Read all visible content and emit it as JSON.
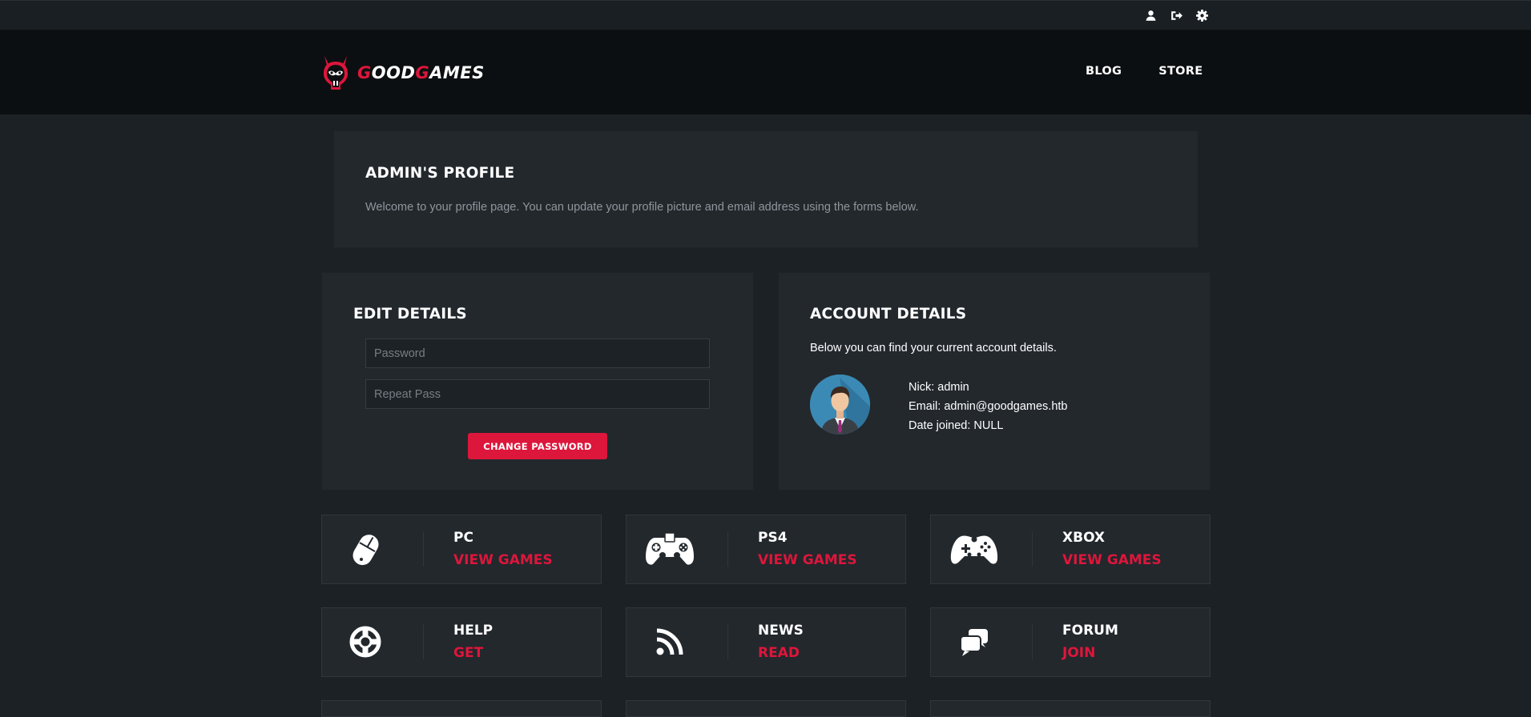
{
  "topbar": {
    "icons": [
      "user-icon",
      "sign-out-icon",
      "gear-icon"
    ]
  },
  "brand": {
    "part1": "G",
    "part2": "OOD",
    "part3": "G",
    "part4": "AMES"
  },
  "nav": [
    {
      "label": "BLOG"
    },
    {
      "label": "STORE"
    }
  ],
  "profile": {
    "title": "ADMIN'S PROFILE",
    "text": "Welcome to your profile page. You can update your profile picture and email address using the forms below."
  },
  "edit": {
    "title": "EDIT DETAILS",
    "password_placeholder": "Password",
    "repeat_placeholder": "Repeat Pass",
    "button": "CHANGE PASSWORD"
  },
  "account": {
    "title": "ACCOUNT DETAILS",
    "subtitle": "Below you can find your current account details.",
    "nick": "Nick: admin",
    "email": "Email: admin@goodgames.htb",
    "joined": "Date joined: NULL"
  },
  "cards": [
    {
      "title": "PC",
      "action": "VIEW GAMES",
      "icon": "mouse-icon"
    },
    {
      "title": "PS4",
      "action": "VIEW GAMES",
      "icon": "ps4-gamepad-icon"
    },
    {
      "title": "XBOX",
      "action": "VIEW GAMES",
      "icon": "xbox-gamepad-icon"
    },
    {
      "title": "HELP",
      "action": "GET",
      "icon": "lifebuoy-icon"
    },
    {
      "title": "NEWS",
      "action": "READ",
      "icon": "rss-icon"
    },
    {
      "title": "FORUM",
      "action": "JOIN",
      "icon": "chat-icon"
    }
  ],
  "colors": {
    "accent": "#dd163b",
    "background": "#1b2125",
    "panel": "#23282d",
    "header": "#0c0f11"
  }
}
